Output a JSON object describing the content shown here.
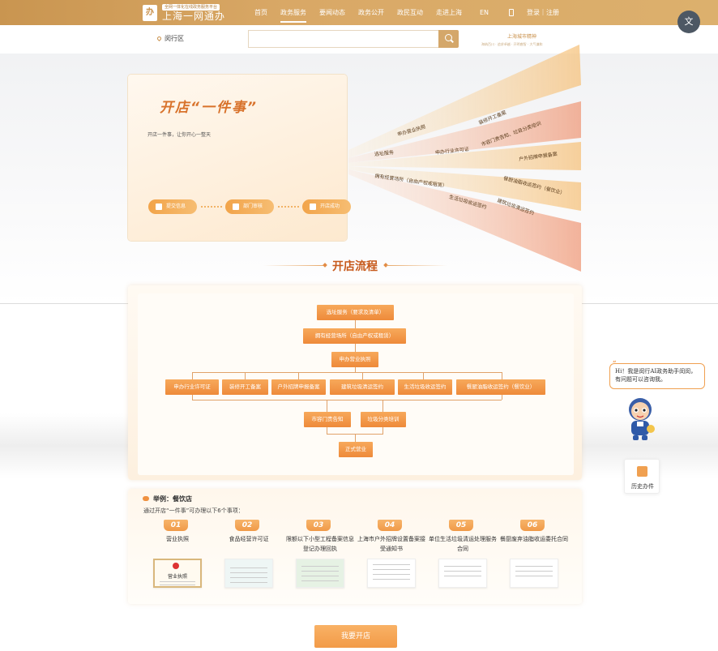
{
  "header": {
    "logo_sub": "全网一体化在线政务服务平台",
    "logo_main": "上海一网通办",
    "logo_char": "办",
    "nav": [
      {
        "label": "首页",
        "active": false
      },
      {
        "label": "政务服务",
        "active": true
      },
      {
        "label": "要闻动态",
        "active": false
      },
      {
        "label": "政务公开",
        "active": false
      },
      {
        "label": "政民互动",
        "active": false
      },
      {
        "label": "走进上海",
        "active": false
      },
      {
        "label": "EN",
        "active": false
      }
    ],
    "login": "登录｜注册",
    "translate_label": "文"
  },
  "search": {
    "location": "闵行区",
    "placeholder": "",
    "city_spirit": "上海城市精神",
    "city_spirit_sub": "海纳百川 · 追求卓越 · 开明睿智 · 大气谦和"
  },
  "hero": {
    "title": "开店“一件事”",
    "subtitle": "开店一件事，让你开心一整天",
    "steps": [
      "提交信息",
      "部门审核",
      "开店成功"
    ],
    "tags": [
      "申办营业执照",
      "装修开工备案",
      "市容门责告知、垃圾分类培训",
      "选址服务",
      "申办行业许可证",
      "户外招牌申报备案",
      "拥有经营场所（自由产权或租赁）",
      "餐厨油脂收运签约（餐饮业）",
      "生活垃圾收运签约",
      "建筑垃圾清运签约"
    ]
  },
  "process": {
    "title": "开店流程",
    "row1": "选址服务（要求及清单）",
    "row2": "拥有经营场所（自由产权或租赁）",
    "row3": "申办营业执照",
    "row4": [
      "申办行业许可证",
      "装修开工备案",
      "户外招牌申报备案",
      "建筑垃圾清运签约",
      "生活垃圾收运签约",
      "餐厨油脂收运签约（餐饮业）"
    ],
    "row5": [
      "市容门责告知",
      "垃圾分类培训"
    ],
    "row6": "正式营业"
  },
  "example": {
    "title": "举例：餐饮店",
    "subtitle": "通过开店“一件事”可办理以下6个事项：",
    "items": [
      {
        "num": "01",
        "label": "营业执照"
      },
      {
        "num": "02",
        "label": "食品经营许可证"
      },
      {
        "num": "03",
        "label": "限额以下小型工程备案信息登记办理回执"
      },
      {
        "num": "04",
        "label": "上海市户外招牌设置备案接受通知书"
      },
      {
        "num": "05",
        "label": "单位生活垃圾清运处理服务合同"
      },
      {
        "num": "06",
        "label": "餐厨废弃油脂收运委托合同"
      }
    ],
    "doc_text": "营业执照"
  },
  "cta": {
    "label": "我要开店"
  },
  "assistant": {
    "mark": "Hi",
    "text": "Hi！我是闵行AI政务助手闵闵，有问题可以咨询我。",
    "history": "历史办件"
  },
  "colors": {
    "brand": "#d4a76a",
    "accent": "#f0913f",
    "title": "#c75a1c"
  }
}
